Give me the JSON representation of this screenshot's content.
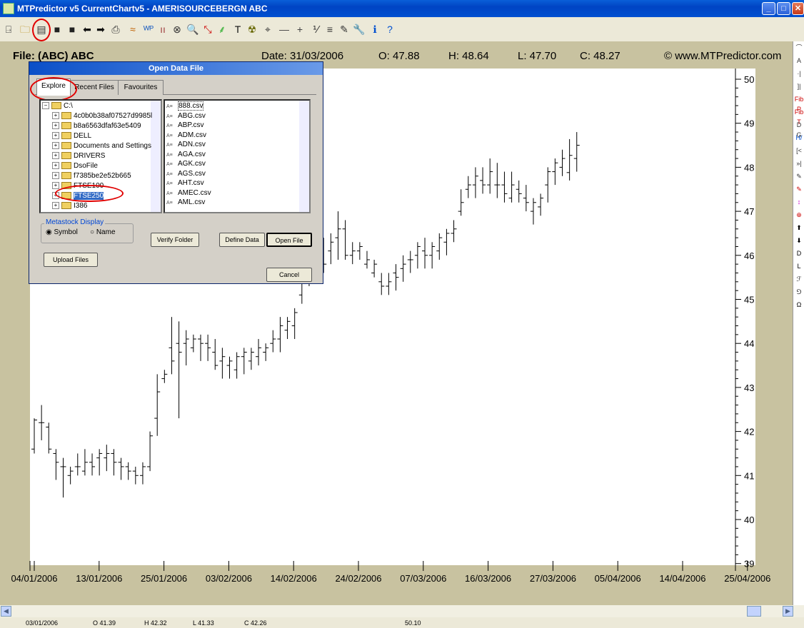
{
  "window": {
    "title": "MTPredictor v5 CurrentChartv5 - AMERISOURCEBERGN ABC",
    "buttons": {
      "minimize": "_",
      "maximize": "□",
      "close": "✕"
    }
  },
  "toolbar": {
    "icons": [
      "exit-icon",
      "open-folder-icon",
      "open-data-file-icon",
      "save-icon",
      "save-as-icon",
      "back-icon",
      "forward-icon",
      "print-icon",
      "wave-icon",
      "wp-icon",
      "bars-icon",
      "zoom-icon",
      "search-icon",
      "trend-icon",
      "fan-icon",
      "text-tool-icon",
      "radiation-icon",
      "cursor-icon",
      "line-tool-icon",
      "crosshair-icon",
      "ratio-icon",
      "grid-icon",
      "pencil-icon",
      "wrench-icon",
      "info-icon",
      "help-icon"
    ],
    "glyphs": [
      "⍈",
      "🗀",
      "▤",
      "■",
      "■",
      "⬅",
      "➡",
      "⎙",
      "≈",
      "ᵂᴾ",
      "ıı",
      "⊗",
      "🔍",
      "⤡",
      "⸙",
      "T",
      "☢",
      "⌖",
      "—",
      "+",
      "⅟",
      "≡",
      "✎",
      "🔧",
      "ℹ",
      "?"
    ]
  },
  "chart_header": {
    "file": "File: (ABC) ABC",
    "date": "Date: 31/03/2006",
    "open": "O: 47.88",
    "high": "H: 48.64",
    "low": "L: 47.70",
    "close": "C: 48.27",
    "copyright": "© www.MTPredictor.com"
  },
  "dialog": {
    "title": "Open Data File",
    "tabs": [
      "Explore",
      "Recent Files",
      "Favourites"
    ],
    "tree": [
      {
        "label": "C:\\",
        "root": true
      },
      {
        "label": "4c0b0b38af07527d9985l"
      },
      {
        "label": "b8a6563dfaf63e5409"
      },
      {
        "label": "DELL"
      },
      {
        "label": "Documents and Settings"
      },
      {
        "label": "DRIVERS"
      },
      {
        "label": "DsoFile"
      },
      {
        "label": "f7385be2e52b665"
      },
      {
        "label": "FTSE100"
      },
      {
        "label": "FTSE250",
        "selected": true
      },
      {
        "label": "I386"
      }
    ],
    "files": [
      "888.csv",
      "ABG.csv",
      "ABP.csv",
      "ADM.csv",
      "ADN.csv",
      "AGA.csv",
      "AGK.csv",
      "AGS.csv",
      "AHT.csv",
      "AMEC.csv",
      "AML.csv"
    ],
    "file_icon": "A≡",
    "metastock_label": "Metastock Display",
    "radio_symbol": "Symbol",
    "radio_name": "Name",
    "verify_button": "Verify Folder",
    "define_button": "Define Data",
    "open_button": "Open File",
    "upload_button": "Upload Files",
    "cancel_button": "Cancel"
  },
  "right_panel": {
    "glyphs": [
      "⌒",
      "A",
      "·|",
      "]|",
      "Fib P",
      "Fib T",
      "D G",
      "H/",
      "[<",
      "»|",
      "✎",
      "✎",
      "↕",
      "⊕",
      "⬆",
      "⬇",
      "D",
      "L",
      "ℱ",
      "⅁",
      "Ω"
    ]
  },
  "status": {
    "date": "03/01/2006",
    "open": "O 41.39",
    "high": "H 42.32",
    "low": "L 41.33",
    "close": "C 42.26",
    "value": "50.10"
  },
  "chart_data": {
    "type": "bar",
    "subtype": "ohlc",
    "y_ticks": [
      "50",
      "49",
      "48",
      "47",
      "46",
      "45",
      "44",
      "43",
      "42",
      "41",
      "40",
      "39"
    ],
    "ylim": [
      39,
      50.3
    ],
    "x_ticks": [
      "04/01/2006",
      "13/01/2006",
      "25/01/2006",
      "03/02/2006",
      "14/02/2006",
      "24/02/2006",
      "07/03/2006",
      "16/03/2006",
      "27/03/2006",
      "05/04/2006",
      "14/04/2006",
      "25/04/2006"
    ],
    "bars": [
      [
        41.6,
        42.3,
        41.5,
        42.26
      ],
      [
        42.2,
        42.6,
        41.8,
        42.2
      ],
      [
        42.1,
        42.2,
        41.5,
        41.6
      ],
      [
        41.5,
        41.6,
        40.9,
        41.3
      ],
      [
        41.2,
        41.4,
        40.5,
        41.2
      ],
      [
        41.0,
        41.2,
        40.8,
        41.1
      ],
      [
        41.2,
        41.5,
        41.0,
        41.2
      ],
      [
        41.1,
        41.6,
        41.0,
        41.3
      ],
      [
        41.3,
        41.5,
        41.0,
        41.2
      ],
      [
        41.4,
        41.6,
        41.0,
        41.5
      ],
      [
        41.4,
        41.7,
        41.1,
        41.5
      ],
      [
        41.5,
        41.6,
        41.0,
        41.3
      ],
      [
        41.3,
        41.4,
        40.9,
        41.2
      ],
      [
        41.2,
        41.3,
        40.9,
        41.1
      ],
      [
        41.1,
        41.2,
        40.8,
        41.0
      ],
      [
        41.0,
        41.3,
        40.8,
        41.2
      ],
      [
        41.2,
        42.0,
        41.1,
        41.9
      ],
      [
        42.3,
        43.3,
        41.9,
        42.9
      ],
      [
        43.2,
        43.4,
        43.1,
        43.3
      ],
      [
        43.9,
        44.6,
        43.3,
        43.6
      ],
      [
        44.0,
        44.5,
        42.3,
        43.8
      ],
      [
        44.0,
        44.3,
        43.5,
        44.1
      ],
      [
        43.9,
        44.2,
        43.8,
        44.1
      ],
      [
        44.1,
        44.2,
        43.6,
        44.0
      ],
      [
        44.0,
        44.2,
        43.6,
        43.9
      ],
      [
        43.8,
        44.1,
        43.4,
        43.5
      ],
      [
        43.6,
        43.9,
        43.2,
        43.7
      ],
      [
        43.5,
        43.7,
        43.2,
        43.6
      ],
      [
        43.4,
        43.8,
        43.2,
        43.7
      ],
      [
        43.7,
        43.9,
        43.3,
        43.8
      ],
      [
        43.6,
        43.9,
        43.4,
        43.8
      ],
      [
        43.7,
        44.1,
        43.5,
        43.9
      ],
      [
        43.8,
        44.0,
        43.6,
        43.9
      ],
      [
        44.0,
        44.3,
        43.8,
        44.1
      ],
      [
        44.1,
        44.6,
        43.8,
        44.4
      ],
      [
        44.3,
        44.6,
        44.1,
        44.5
      ],
      [
        44.4,
        44.8,
        44.1,
        44.7
      ],
      [
        45.1,
        45.8,
        44.9,
        45.5
      ],
      [
        45.6,
        46.4,
        45.3,
        45.9
      ],
      [
        46.0,
        46.6,
        45.7,
        46.2
      ],
      [
        46.0,
        46.4,
        45.6,
        45.8
      ],
      [
        46.1,
        46.5,
        45.8,
        46.3
      ],
      [
        46.4,
        47.0,
        45.9,
        46.6
      ],
      [
        46.6,
        46.8,
        45.9,
        46.0
      ],
      [
        46.0,
        46.3,
        45.8,
        46.1
      ],
      [
        46.1,
        46.3,
        45.9,
        46.2
      ],
      [
        45.8,
        46.1,
        45.7,
        45.9
      ],
      [
        45.6,
        45.9,
        45.5,
        45.8
      ],
      [
        45.4,
        45.6,
        45.1,
        45.3
      ],
      [
        45.3,
        45.6,
        45.1,
        45.4
      ],
      [
        45.6,
        45.8,
        45.2,
        45.5
      ],
      [
        45.7,
        46.0,
        45.4,
        45.8
      ],
      [
        45.9,
        46.1,
        45.6,
        45.9
      ],
      [
        46.0,
        46.3,
        45.7,
        46.2
      ],
      [
        46.1,
        46.4,
        45.7,
        46.0
      ],
      [
        46.0,
        46.3,
        45.7,
        46.2
      ],
      [
        46.1,
        46.5,
        45.9,
        46.4
      ],
      [
        46.3,
        46.6,
        46.0,
        46.5
      ],
      [
        46.5,
        46.8,
        46.3,
        46.6
      ],
      [
        47.0,
        47.5,
        46.9,
        47.2
      ],
      [
        47.5,
        47.8,
        47.3,
        47.6
      ],
      [
        47.6,
        48.0,
        47.3,
        47.8
      ],
      [
        47.7,
        48.0,
        47.4,
        47.6
      ],
      [
        47.6,
        48.2,
        47.4,
        47.9
      ],
      [
        47.6,
        48.1,
        47.3,
        47.6
      ],
      [
        47.6,
        47.9,
        47.2,
        47.4
      ],
      [
        47.3,
        47.9,
        47.2,
        47.6
      ],
      [
        47.5,
        47.7,
        47.2,
        47.4
      ],
      [
        47.3,
        47.6,
        47.0,
        47.2
      ],
      [
        47.0,
        47.3,
        46.7,
        47.2
      ],
      [
        47.1,
        47.4,
        46.9,
        47.3
      ],
      [
        47.6,
        48.0,
        47.2,
        47.9
      ],
      [
        47.9,
        48.2,
        47.6,
        48.1
      ],
      [
        48.0,
        48.4,
        47.8,
        48.2
      ],
      [
        47.88,
        48.64,
        47.7,
        48.27
      ],
      [
        48.2,
        48.8,
        47.9,
        48.5
      ]
    ],
    "grid": false
  }
}
